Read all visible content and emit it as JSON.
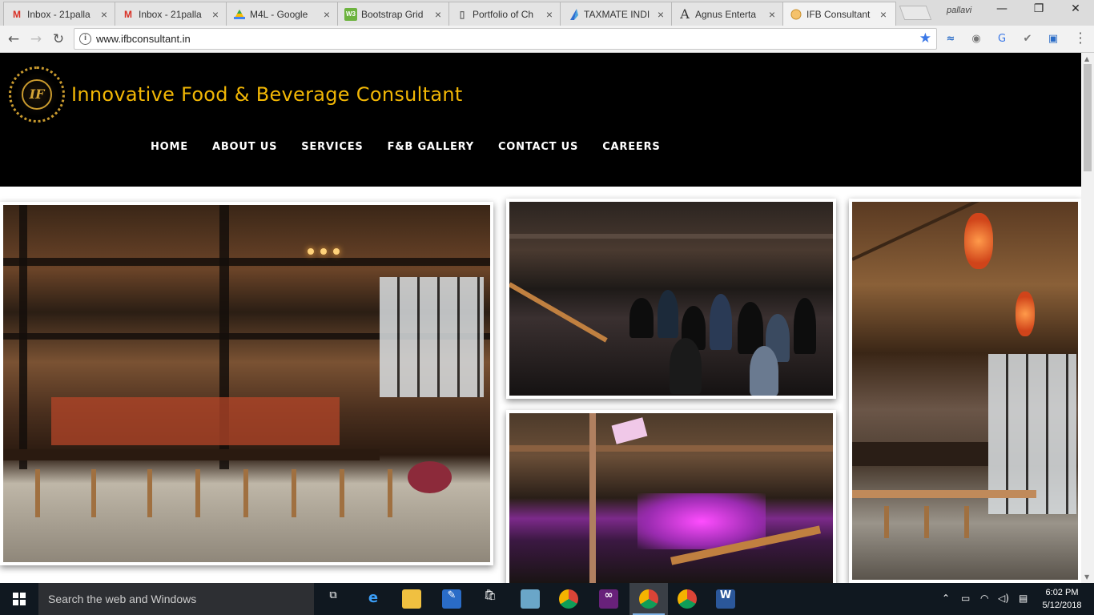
{
  "browser": {
    "tabs": [
      {
        "title": "Inbox - 21palla",
        "icon": "gmail-icon"
      },
      {
        "title": "Inbox - 21palla",
        "icon": "gmail-icon"
      },
      {
        "title": "M4L - Google",
        "icon": "google-drive-icon"
      },
      {
        "title": "Bootstrap Grid",
        "icon": "bootstrap-icon"
      },
      {
        "title": "Portfolio of Ch",
        "icon": "page-icon"
      },
      {
        "title": "TAXMATE INDI",
        "icon": "taxmate-icon"
      },
      {
        "title": "Agnus Enterta",
        "icon": "letter-a-icon"
      },
      {
        "title": "IFB Consultant",
        "icon": "ifb-icon"
      }
    ],
    "profile_name": "pallavi",
    "window_controls": {
      "minimize": "—",
      "maximize": "❐",
      "close": "✕"
    },
    "url": "www.ifbconsultant.in"
  },
  "site": {
    "title": "Innovative Food & Beverage Consultant",
    "logo_mark": "IF",
    "nav": [
      "HOME",
      "ABOUT US",
      "SERVICES",
      "F&B GALLERY",
      "CONTACT US",
      "CAREERS"
    ]
  },
  "taskbar": {
    "search_placeholder": "Search the web and Windows",
    "time": "6:02 PM",
    "date": "5/12/2018",
    "word_icon_label": "W"
  },
  "colors": {
    "header_bg": "#000000",
    "title_gold": "#f2b705",
    "nav_text": "#ffffff"
  }
}
